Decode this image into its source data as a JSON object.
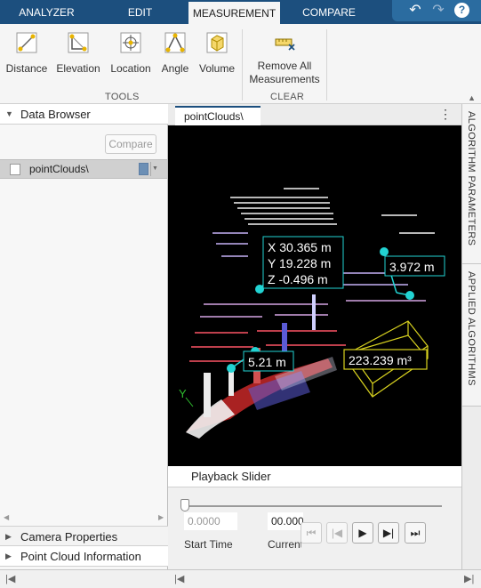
{
  "tabs": [
    "ANALYZER",
    "EDIT",
    "MEASUREMENT",
    "COMPARE"
  ],
  "active_tab": "MEASUREMENT",
  "quick_access": {
    "undo": "↶",
    "redo": "↷",
    "help": "?"
  },
  "tools_group": {
    "label": "TOOLS",
    "items": [
      "Distance",
      "Elevation",
      "Location",
      "Angle",
      "Volume"
    ]
  },
  "clear_group": {
    "label": "CLEAR",
    "remove_line1": "Remove All",
    "remove_line2": "Measurements"
  },
  "data_browser": {
    "title": "Data Browser",
    "compare_label": "Compare",
    "item_label": "pointClouds\\"
  },
  "bottom_panels": [
    "Camera Properties",
    "Point Cloud Information"
  ],
  "document_tab": "pointClouds\\",
  "measurements": {
    "location_x": "X 30.365 m",
    "location_y": "Y 19.228 m",
    "location_z": "Z -0.496 m",
    "angle_or_distance_a": "3.972 m",
    "distance": "5.21 m",
    "volume": "223.239 m³"
  },
  "axis_label_y": "Y",
  "playback": {
    "title": "Playback Slider",
    "start_value": "0.0000",
    "current_value": "00.000",
    "start_label": "Start Time",
    "current_label": "Current"
  },
  "right_tabs": [
    "ALGORITHM PARAMETERS",
    "APPLIED ALGORITHMS"
  ],
  "colors": {
    "tabstrip": "#1c4f7e",
    "measure_cyan": "#22d3d3",
    "measure_yellow": "#d8d21f"
  }
}
